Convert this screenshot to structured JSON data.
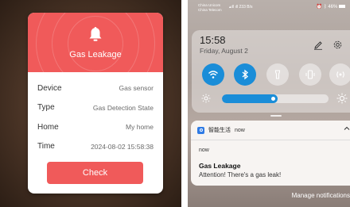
{
  "alarm_card": {
    "title": "Gas Leakage",
    "rows": [
      {
        "label": "Device",
        "value": "Gas sensor"
      },
      {
        "label": "Type",
        "value": "Gas Detection State"
      },
      {
        "label": "Home",
        "value": "My home"
      },
      {
        "label": "Time",
        "value": "2024-08-02 15:58:38"
      }
    ],
    "check_label": "Check",
    "accent_color": "#f05a5a"
  },
  "status_bar": {
    "carrier_1": "China Unicom",
    "carrier_2": "China Telecom",
    "network_speed": "233 B/s",
    "battery": "46%"
  },
  "quick_settings": {
    "time": "15:58",
    "date": "Friday, August 2",
    "tiles": [
      {
        "icon": "wifi-icon",
        "state": "on"
      },
      {
        "icon": "bluetooth-icon",
        "state": "on"
      },
      {
        "icon": "flashlight-icon",
        "state": "off"
      },
      {
        "icon": "vibrate-icon",
        "state": "off"
      },
      {
        "icon": "nfc-icon",
        "state": "off"
      }
    ],
    "brightness": 0.52,
    "accent_color": "#1a8dd8"
  },
  "notification": {
    "app_name": "智能生活",
    "when": "now",
    "sub": "now",
    "title": "Gas Leakage",
    "body": "Attention! There's a gas leak!"
  },
  "manage_label": "Manage notifications"
}
